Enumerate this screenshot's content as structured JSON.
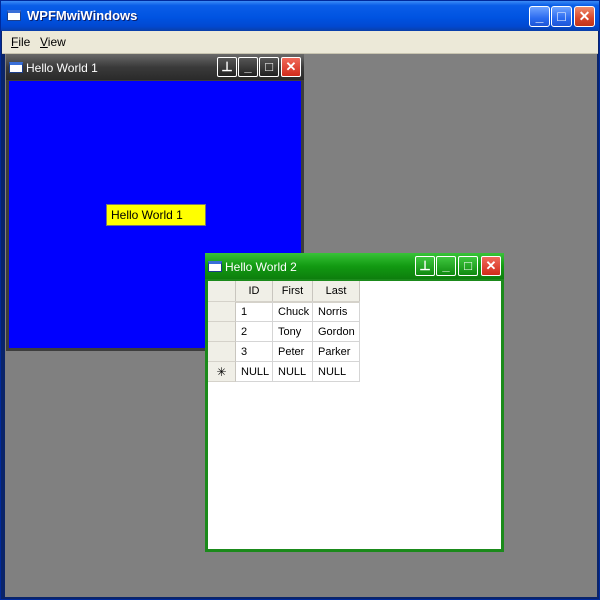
{
  "app": {
    "title": "WPFMwiWindows",
    "controls": {
      "minimize": "_",
      "maximize": "□",
      "close": "✕"
    }
  },
  "menu": {
    "items": [
      {
        "key": "F",
        "rest": "ile"
      },
      {
        "key": "V",
        "rest": "iew"
      }
    ]
  },
  "windows": [
    {
      "title": "Hello World 1",
      "content_label": "Hello World 1",
      "colors": {
        "frame": "#3d3d3d",
        "body": "#0000ff",
        "label_bg": "#ffff00"
      },
      "icons": [
        "window-icon",
        "pin-icon",
        "minimize-icon",
        "maximize-icon",
        "close-icon"
      ]
    },
    {
      "title": "Hello World 2",
      "colors": {
        "frame": "#1b8a1b",
        "body": "#ffffff"
      },
      "icons": [
        "window-icon",
        "pin-icon",
        "minimize-icon",
        "maximize-icon",
        "close-icon"
      ],
      "grid": {
        "columns": [
          "ID",
          "First",
          "Last"
        ],
        "rows": [
          [
            "1",
            "Chuck",
            "Norris"
          ],
          [
            "2",
            "Tony",
            "Gordon"
          ],
          [
            "3",
            "Peter",
            "Parker"
          ]
        ],
        "new_row": {
          "marker": "✳",
          "values": [
            "NULL",
            "NULL",
            "NULL"
          ]
        }
      }
    }
  ],
  "glyphs": {
    "pin": "⊥",
    "minimize": "_",
    "maximize": "□",
    "close": "✕"
  }
}
